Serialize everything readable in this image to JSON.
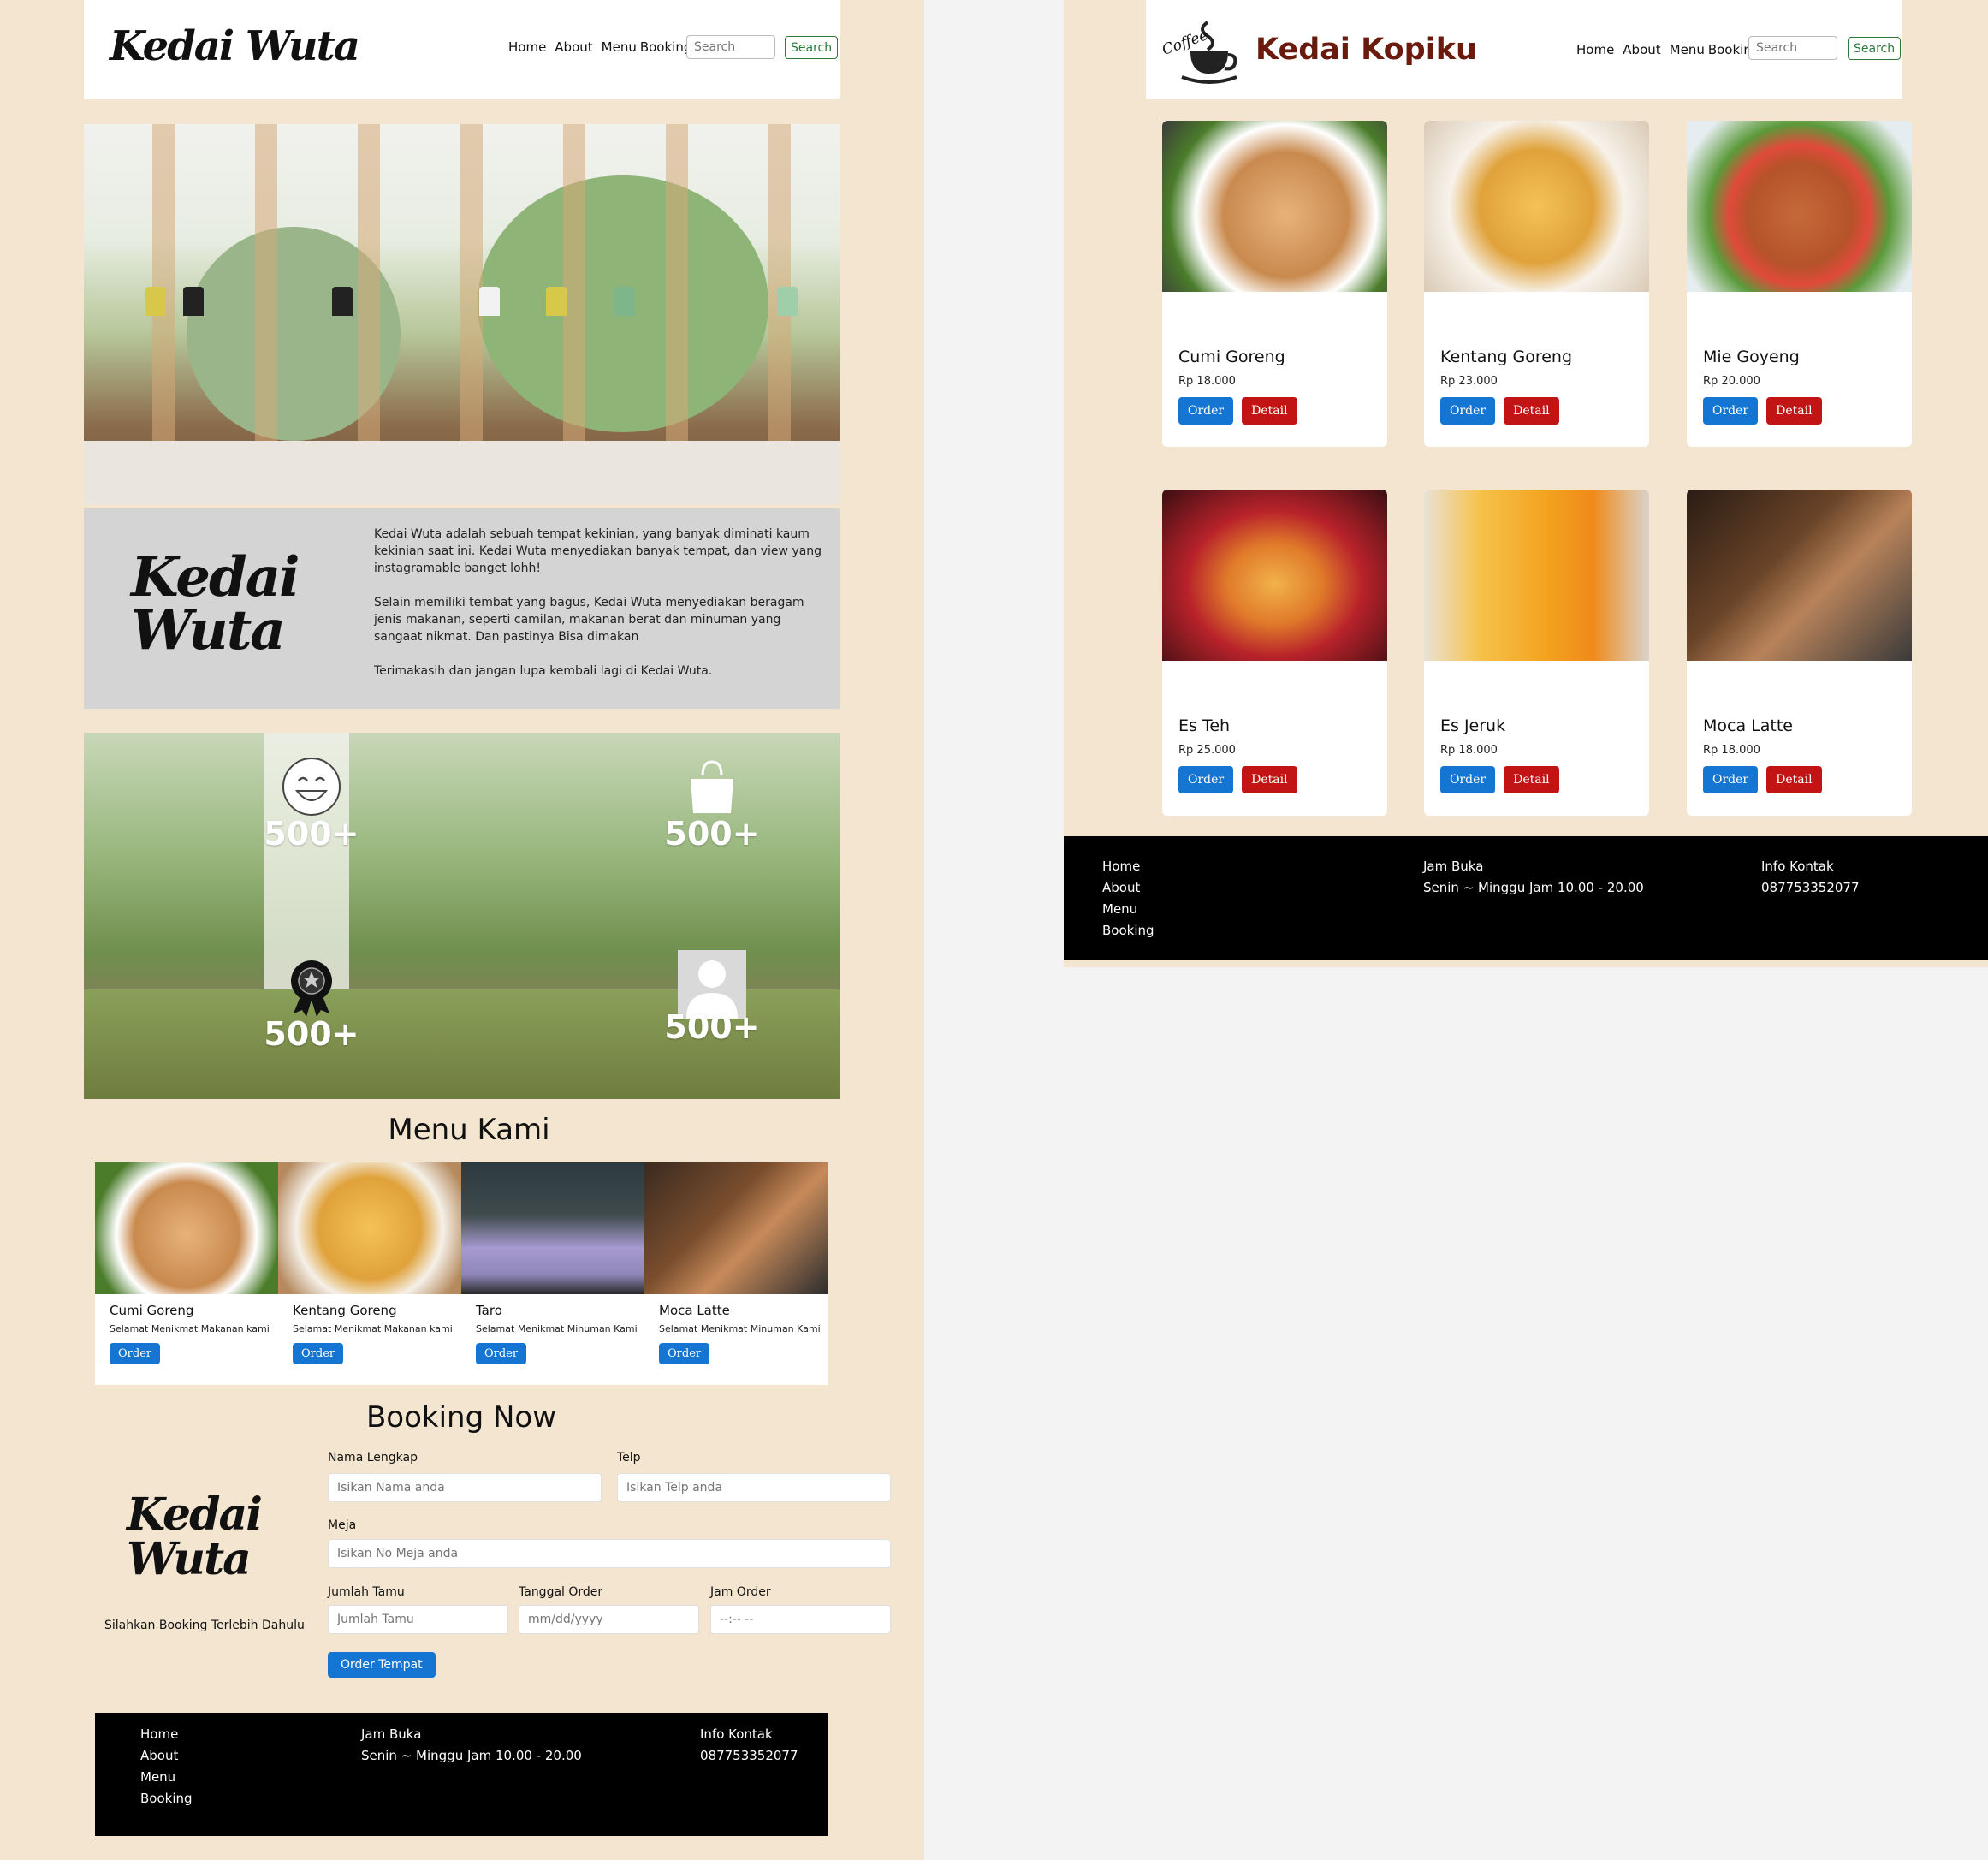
{
  "left": {
    "brand": "Kedai Wuta",
    "nav": [
      "Home",
      "About",
      "Menu",
      "Booking"
    ],
    "search_placeholder": "Search",
    "search_button": "Search",
    "about_logo_line1": "Kedai",
    "about_logo_line2": "Wuta",
    "about_paragraphs": [
      "Kedai Wuta adalah sebuah tempat kekinian, yang banyak diminati kaum kekinian saat ini. Kedai Wuta menyediakan banyak tempat, dan view yang instagramable banget lohh!",
      "Selain memiliki tembat yang bagus, Kedai Wuta menyediakan beragam jenis makanan, seperti camilan, makanan berat dan minuman yang sangaat nikmat. Dan pastinya Bisa dimakan",
      "Terimakasih dan jangan lupa kembali lagi di Kedai Wuta."
    ],
    "stats": [
      {
        "value": "500+",
        "icon": "smiley-icon"
      },
      {
        "value": "500+",
        "icon": "shopping-bag-icon"
      },
      {
        "value": "500+",
        "icon": "award-badge-icon"
      },
      {
        "value": "500+",
        "icon": "user-icon"
      }
    ],
    "menu_title": "Menu Kami",
    "menu": [
      {
        "name": "Cumi Goreng",
        "desc": "Selamat Menikmat Makanan kami",
        "order": "Order",
        "color": "#c98a4e"
      },
      {
        "name": "Kentang Goreng",
        "desc": "Selamat Menikmat Makanan kami",
        "order": "Order",
        "color": "#e0a23b"
      },
      {
        "name": "Taro",
        "desc": "Selamat Menikmat Minuman Kami",
        "order": "Order",
        "color": "#8f86b8"
      },
      {
        "name": "Moca Latte",
        "desc": "Selamat Menikmat Minuman Kami",
        "order": "Order",
        "color": "#7a4e2d"
      }
    ],
    "booking": {
      "title": "Booking Now",
      "logo_line1": "Kedai",
      "logo_line2": "Wuta",
      "caption": "Silahkan Booking Terlebih Dahulu",
      "labels": {
        "name": "Nama Lengkap",
        "phone": "Telp",
        "table": "Meja",
        "guests": "Jumlah Tamu",
        "date": "Tanggal Order",
        "time": "Jam Order"
      },
      "placeholders": {
        "name": "Isikan Nama anda",
        "phone": "Isikan Telp anda",
        "table": "Isikan No Meja anda",
        "guests": "Jumlah Tamu",
        "date": "mm/dd/yyyy",
        "time": "--:-- --"
      },
      "submit": "Order Tempat"
    },
    "footer": {
      "links": [
        "Home",
        "About",
        "Menu",
        "Booking"
      ],
      "hours_title": "Jam Buka",
      "hours": "Senin ~ Minggu Jam 10.00 - 20.00",
      "contact_title": "Info Kontak",
      "contact": "087753352077"
    }
  },
  "right": {
    "logo_text": "Coffee",
    "brand": "Kedai Kopiku",
    "brand_color": "#6b1a0e",
    "nav": [
      "Home",
      "About",
      "Menu",
      "Booking"
    ],
    "search_placeholder": "Search",
    "search_button": "Search",
    "products": [
      {
        "name": "Cumi Goreng",
        "price": "Rp 18.000",
        "color": "#c98a4e"
      },
      {
        "name": "Kentang Goreng",
        "price": "Rp 23.000",
        "color": "#e0a23b"
      },
      {
        "name": "Mie Goyeng",
        "price": "Rp 20.000",
        "color": "#b5532a"
      },
      {
        "name": "Es Teh",
        "price": "Rp 25.000",
        "color": "#e07a2a"
      },
      {
        "name": "Es Jeruk",
        "price": "Rp 18.000",
        "color": "#f3a21e"
      },
      {
        "name": "Moca Latte",
        "price": "Rp 18.000",
        "color": "#6a4428"
      }
    ],
    "order_label": "Order",
    "detail_label": "Detail",
    "footer": {
      "links": [
        "Home",
        "About",
        "Menu",
        "Booking"
      ],
      "hours_title": "Jam Buka",
      "hours": "Senin ~ Minggu Jam 10.00 - 20.00",
      "contact_title": "Info Kontak",
      "contact": "087753352077"
    }
  }
}
